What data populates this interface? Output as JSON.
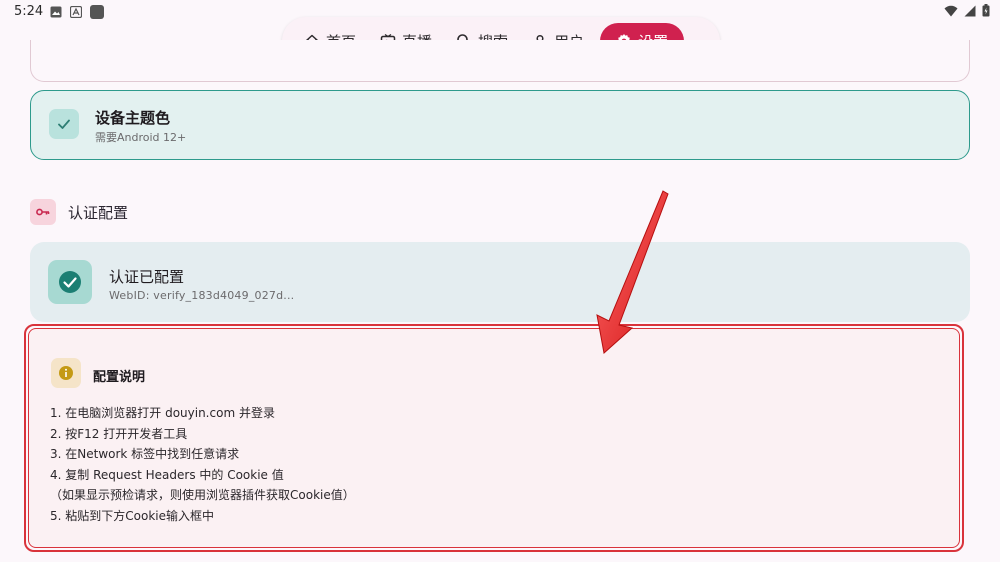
{
  "status_bar": {
    "time": "5:24"
  },
  "nav": {
    "items": [
      {
        "label": "首页"
      },
      {
        "label": "直播"
      },
      {
        "label": "搜索"
      },
      {
        "label": "用户"
      },
      {
        "label": "设置"
      }
    ],
    "active": "设置"
  },
  "theme_card": {
    "title": "设备主题色",
    "subtitle": "需要Android 12+"
  },
  "auth_section": {
    "title": "认证配置"
  },
  "auth_card": {
    "title": "认证已配置",
    "subtitle": "WebID: verify_183d4049_027d..."
  },
  "info_card": {
    "title": "配置说明",
    "lines": [
      "1. 在电脑浏览器打开 douyin.com 并登录",
      "2. 按F12 打开开发者工具",
      "3. 在Network 标签中找到任意请求",
      "4. 复制 Request Headers 中的 Cookie 值",
      "（如果显示预检请求，则使用浏览器插件获取Cookie值）",
      "5. 粘贴到下方Cookie输入框中"
    ]
  },
  "colors": {
    "accent": "#d0214f",
    "teal": "#2e9a8c",
    "highlight_red": "#d9333b"
  }
}
